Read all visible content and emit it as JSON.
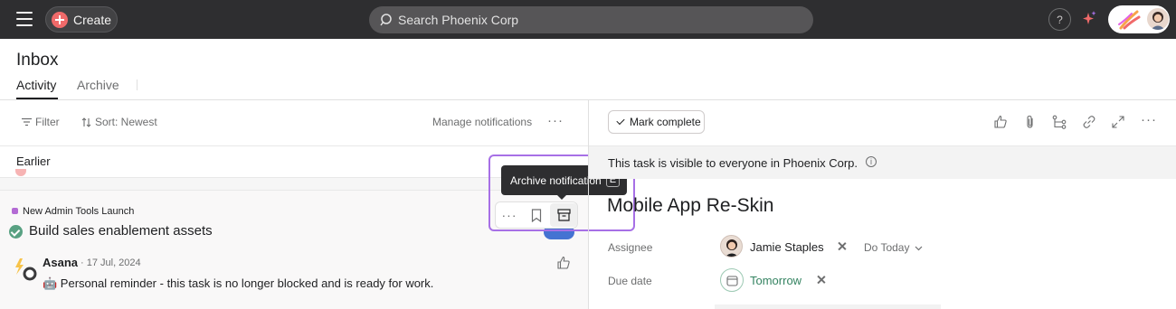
{
  "topbar": {
    "create_label": "Create",
    "search_placeholder": "Search Phoenix Corp",
    "help_label": "?"
  },
  "header": {
    "title": "Inbox",
    "tabs": [
      {
        "label": "Activity",
        "active": true
      },
      {
        "label": "Archive",
        "active": false
      }
    ]
  },
  "list_toolbar": {
    "filter_label": "Filter",
    "sort_label": "Sort: Newest",
    "manage_label": "Manage notifications",
    "more_label": "···"
  },
  "section": {
    "label": "Earlier"
  },
  "notification": {
    "project": "New Admin Tools Launch",
    "task": "Build sales enablement assets",
    "author": "Asana",
    "date": "· 17 Jul, 2024",
    "body": "🤖 Personal reminder - this task is no longer blocked and is ready for work."
  },
  "hover_actions": {
    "tooltip": "Archive notification",
    "shortcut": "E",
    "dots": "···"
  },
  "task_pane": {
    "mark_complete": "Mark complete",
    "visibility_text": "This task is visible to everyone in Phoenix Corp.",
    "info": "i",
    "title": "Mobile App Re-Skin",
    "toolbar_more": "···",
    "fields": {
      "assignee_label": "Assignee",
      "assignee_name": "Jamie Staples",
      "do_today": "Do Today",
      "due_label": "Due date",
      "due_value": "Tomorrow"
    }
  },
  "colors": {
    "topbar_bg": "#2e2e30",
    "create_accent": "#f06a6a",
    "complete_green": "#58a182",
    "due_green": "#348361",
    "focus_purple": "#a770e6",
    "project_purple": "#b36bd4"
  }
}
